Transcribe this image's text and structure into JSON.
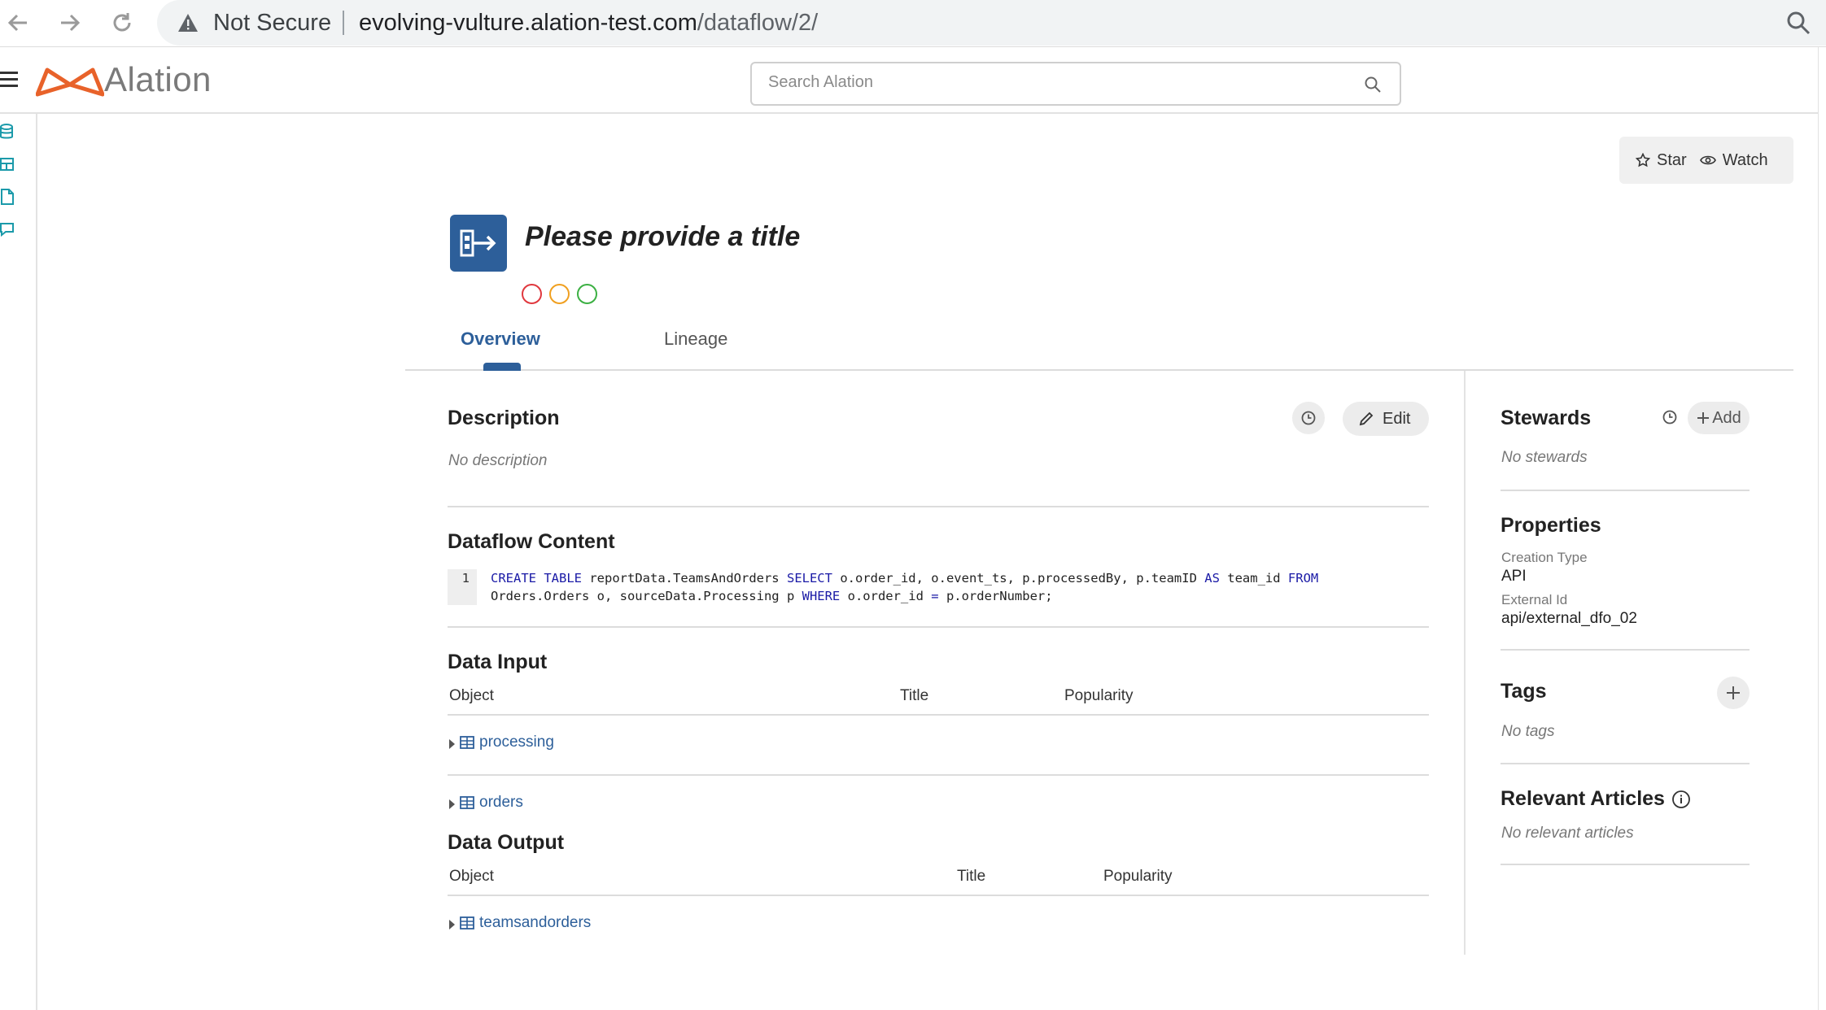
{
  "browser": {
    "security_label": "Not Secure",
    "url_host": "evolving-vulture.alation-test.com",
    "url_path": "/dataflow/2/"
  },
  "header": {
    "logo_text": "Alation",
    "search_placeholder": "Search Alation"
  },
  "actions": {
    "star_label": "Star",
    "watch_label": "Watch"
  },
  "page": {
    "title": "Please provide a title",
    "trust_signals": [
      "#e0383e",
      "#f0a020",
      "#3cb043"
    ]
  },
  "tabs": [
    {
      "label": "Overview",
      "active": true
    },
    {
      "label": "Lineage",
      "active": false
    }
  ],
  "description": {
    "heading": "Description",
    "edit_label": "Edit",
    "empty_text": "No description"
  },
  "dataflow_content": {
    "heading": "Dataflow Content",
    "line_number": "1"
  },
  "data_input": {
    "heading": "Data Input",
    "columns": [
      "Object",
      "Title",
      "Popularity"
    ],
    "rows": [
      {
        "name": "processing"
      },
      {
        "name": "orders"
      }
    ]
  },
  "data_output": {
    "heading": "Data Output",
    "columns": [
      "Object",
      "Title",
      "Popularity"
    ],
    "rows": [
      {
        "name": "teamsandorders"
      }
    ]
  },
  "sidebar": {
    "stewards": {
      "heading": "Stewards",
      "add_label": "Add",
      "empty_text": "No stewards"
    },
    "properties": {
      "heading": "Properties",
      "items": [
        {
          "label": "Creation Type",
          "value": "API"
        },
        {
          "label": "External Id",
          "value": "api/external_dfo_02"
        }
      ]
    },
    "tags": {
      "heading": "Tags",
      "empty_text": "No tags"
    },
    "articles": {
      "heading": "Relevant Articles",
      "empty_text": "No relevant articles"
    }
  },
  "colors": {
    "accent": "#2d5f9a",
    "logo_orange": "#e8622a",
    "keyword": "#1a1aa6"
  }
}
